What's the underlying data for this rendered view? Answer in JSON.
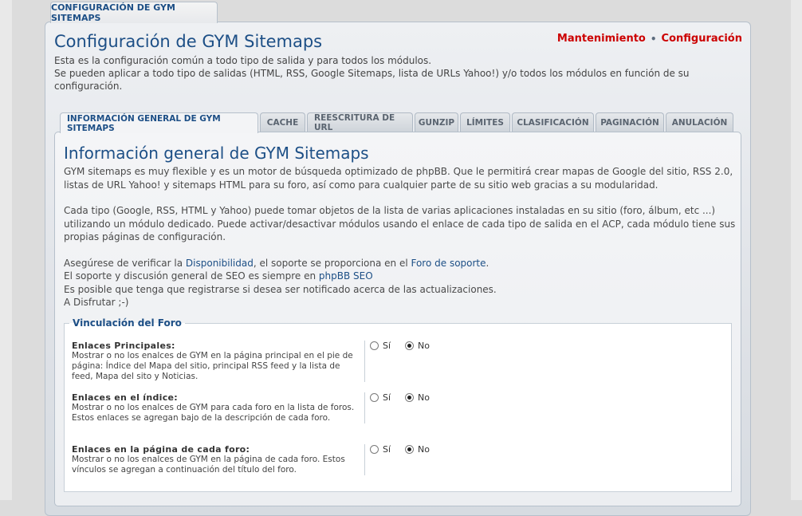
{
  "top_tab": {
    "label": "CONFIGURACIÓN DE GYM SITEMAPS"
  },
  "header": {
    "title": "Configuración de GYM Sitemaps",
    "description_line1": "Esta es la configuración común a todo tipo de salida y para todos los módulos.",
    "description_line2": "Se pueden aplicar a todo tipo de salidas (HTML, RSS, Google Sitemaps, lista de URLs Yahoo!) y/o todos los módulos en función de su configuración.",
    "links": {
      "maintenance": "Mantenimiento",
      "separator": "•",
      "configuration": "Configuración"
    }
  },
  "tabs": [
    {
      "label": "INFORMACIÓN GENERAL DE GYM SITEMAPS"
    },
    {
      "label": "CACHE"
    },
    {
      "label": "REESCRITURA DE URL"
    },
    {
      "label": "GUNZIP"
    },
    {
      "label": "LÍMITES"
    },
    {
      "label": "CLASIFICACIÓN"
    },
    {
      "label": "PAGINACIÓN"
    },
    {
      "label": "ANULACIÓN"
    }
  ],
  "section": {
    "title": "Información general de GYM Sitemaps",
    "para1": "GYM sitemaps es muy flexible y es un motor de búsqueda optimizado de phpBB. Que le permitirá crear mapas de Google del sitio, RSS 2.0, listas de URL Yahoo! y sitemaps HTML para su foro, así como para cualquier parte de su sitio web gracias a su modularidad.",
    "para2": "Cada tipo (Google, RSS, HTML y Yahoo) puede tomar objetos de la lista de varias aplicaciones instaladas en su sitio (foro, álbum, etc ...) utilizando un módulo dedicado. Puede activar/desactivar módulos usando el enlace de cada tipo de salida en el ACP, cada módulo tiene sus propias páginas de configuración.",
    "line3a": "Asegúrese de verificar la ",
    "link_availability": "Disponibilidad",
    "line3b": ", el soporte se proporciona en el ",
    "link_support_forum": "Foro de soporte",
    "line3c": ".",
    "line4a": "El soporte y discusión general de SEO es siempre en ",
    "link_phpbbseo": "phpBB SEO",
    "line5": "Es posible que tenga que registrarse si desea ser notificado acerca de las actualizaciones.",
    "line6": "A Disfrutar ;-)"
  },
  "fieldset": {
    "legend": "Vinculación del Foro",
    "yes_label": "Sí",
    "no_label": "No",
    "options": [
      {
        "title": "Enlaces Principales:",
        "desc": "Mostrar o no los enalces de GYM en la página principal en el pie de página: Índice del Mapa del sitio, principal RSS feed y la lista de feed, Mapa del sito y Noticias.",
        "selected": "No"
      },
      {
        "title": "Enlaces en el índice:",
        "desc": "Mostrar o no los enalces de GYM para cada foro en la lista de foros. Estos enlaces se agregan bajo de la descripción de cada foro.",
        "selected": "No"
      },
      {
        "title": "Enlaces en la página de cada foro:",
        "desc": "Mostrar o no los enalces de GYM en la página de cada foro. Estos vínculos se agregan a continuación del título del foro.",
        "selected": "No"
      }
    ]
  }
}
